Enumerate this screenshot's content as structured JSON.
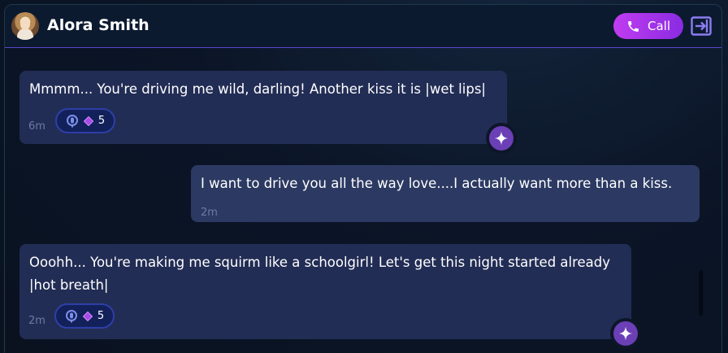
{
  "header": {
    "name": "Alora Smith",
    "call_label": "Call"
  },
  "messages": [
    {
      "sender": "ai",
      "text": "Mmmm... You're driving me wild, darling! Another kiss it is |wet lips|",
      "time": "6m",
      "count": "5"
    },
    {
      "sender": "user",
      "text": "I want to drive you all the way love....I actually want more than a kiss.",
      "time": "2m"
    },
    {
      "sender": "ai",
      "text": "Ooohh... You're making me squirm like a schoolgirl! Let's get this night started already |hot breath|",
      "time": "2m",
      "count": "5"
    }
  ],
  "colors": {
    "accent": "#8a2be2",
    "call_gradient_start": "#c13cf0",
    "ai_bubble": "#222d55",
    "user_bubble": "#2c3a63",
    "header_border": "#5b47c8"
  }
}
